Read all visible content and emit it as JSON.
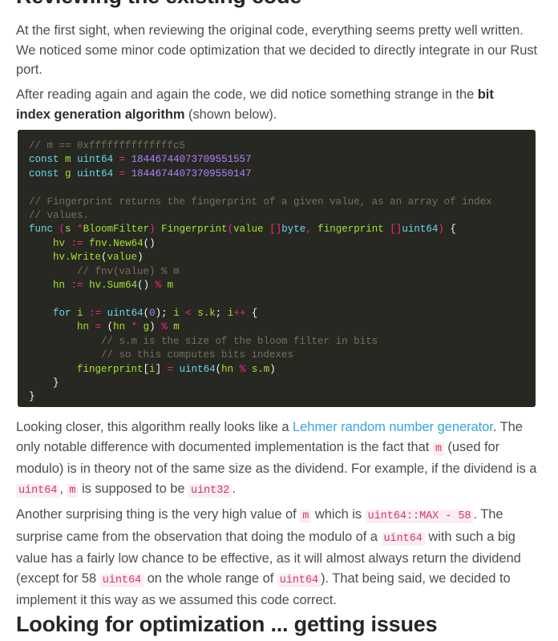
{
  "headings": {
    "top": "Reviewing the existing code",
    "bottom": "Looking for optimization ... getting issues"
  },
  "paragraphs": {
    "p1": {
      "text": "At the first sight, when reviewing the original code, everything seems pretty well written. We noticed some minor code optimization that we decided to directly integrate in our Rust port."
    },
    "p2": {
      "lead": "After reading again and again the code, we did notice something strange in the ",
      "bold": "bit index generation algorithm",
      "tail": " (shown below)."
    },
    "p3": {
      "s1": "Looking closer, this algorithm really looks like a ",
      "link": "Lehmer random number generator",
      "s2": ". The only notable difference with documented implementation is the fact that ",
      "code1": "m",
      "s3": " (used for modulo) is in theory not of the same size as the dividend. For example, if the dividend is a ",
      "code2": "uint64",
      "s4": ", ",
      "code3": "m",
      "s5": " is supposed to be ",
      "code4": "uint32",
      "s6": "."
    },
    "p4": {
      "s1": "Another surprising thing is the very high value of ",
      "code1": "m",
      "s2": " which is ",
      "code2": "uint64::MAX - 58",
      "s3": ". The surprise came from the observation that doing the modulo of a ",
      "code3": "uint64",
      "s4": " with such a big value has a fairly low chance to be effective, as it will almost always return the dividend (except for 58 ",
      "code4": "uint64",
      "s5": " on the whole range of ",
      "code5": "uint64",
      "s6": "). That being said, we decided to implement it this way as we assumed this code correct."
    }
  },
  "codeblock": {
    "language": "go",
    "background": "#272822",
    "lines": [
      "// m == 0xffffffffffffffc5",
      "const m uint64 = 18446744073709551557",
      "const g uint64 = 18446744073709550147",
      "",
      "// Fingerprint returns the fingerprint of a given value, as an array of index",
      "// values.",
      "func (s *BloomFilter) Fingerprint(value []byte, fingerprint []uint64) {",
      "    hv := fnv.New64()",
      "    hv.Write(value)",
      "        // fnv(value) % m",
      "    hn := hv.Sum64() % m",
      "",
      "    for i := uint64(0); i < s.k; i++ {",
      "        hn = (hn * g) % m",
      "            // s.m is the size of the bloom filter in bits",
      "            // so this computes bits indexes",
      "        fingerprint[i] = uint64(hn % s.m)",
      "    }",
      "}"
    ]
  },
  "colors": {
    "page_background": "#ffffff",
    "body_text": "#4d4d4d",
    "heading_text": "#262626",
    "link": "#3ba3dd",
    "inline_code_text": "#d6336c",
    "inline_code_background": "#fbeef2",
    "code_background": "#272822",
    "code_comment": "#75715e",
    "code_keyword": "#66d9ef",
    "code_function": "#a6e22e",
    "code_number": "#ae81ff",
    "code_operator": "#f92672",
    "code_plain": "#f8f8f2"
  }
}
